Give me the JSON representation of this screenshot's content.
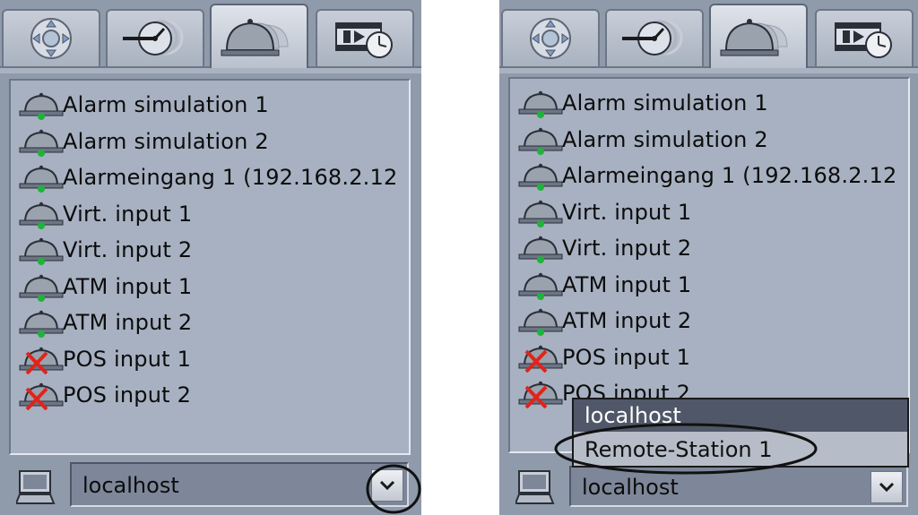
{
  "tabs": [
    {
      "name": "ptz",
      "icon": "ptz-joystick-icon"
    },
    {
      "name": "clock",
      "icon": "timer-clock-icon"
    },
    {
      "name": "alarm",
      "icon": "alarm-bell-icon",
      "active": true
    },
    {
      "name": "playback",
      "icon": "film-clock-icon"
    }
  ],
  "alarm_inputs": [
    {
      "label": "Alarm simulation 1",
      "status": "ok",
      "icon": "alarm-bell-green-icon"
    },
    {
      "label": "Alarm simulation 2",
      "status": "ok",
      "icon": "alarm-bell-green-icon"
    },
    {
      "label": "Alarmeingang 1 (192.168.2.12",
      "status": "ok",
      "icon": "alarm-bell-green-icon"
    },
    {
      "label": "Virt. input 1",
      "status": "ok",
      "icon": "alarm-bell-green-icon"
    },
    {
      "label": "Virt. input 2",
      "status": "ok",
      "icon": "alarm-bell-green-icon"
    },
    {
      "label": "ATM input 1",
      "status": "ok",
      "icon": "alarm-bell-green-icon"
    },
    {
      "label": "ATM input 2",
      "status": "ok",
      "icon": "alarm-bell-green-icon"
    },
    {
      "label": "POS input 1",
      "status": "error",
      "icon": "alarm-bell-red-x-icon"
    },
    {
      "label": "POS input 2",
      "status": "error",
      "icon": "alarm-bell-red-x-icon"
    }
  ],
  "station_selector": {
    "value": "localhost",
    "icon": "computer-monitor-icon"
  },
  "dropdown": {
    "options": [
      "localhost",
      "Remote-Station 1"
    ],
    "highlighted": "localhost"
  },
  "colors": {
    "panel_bg": "#8f9aab",
    "list_bg": "#a7b1c1",
    "status_ok": "#1fb33a",
    "status_error": "#e0241b",
    "highlight": "#4f5768"
  }
}
